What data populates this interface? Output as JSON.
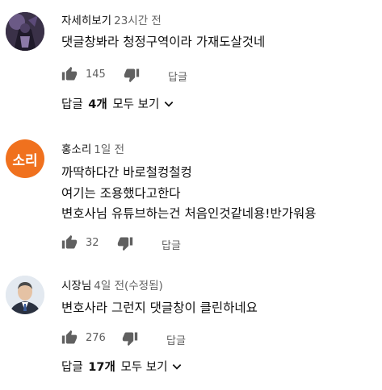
{
  "comments": [
    {
      "author": "자세히보기",
      "time": "23시간 전",
      "lines": [
        "댓글창봐라 청정구역이라 가재도살것네"
      ],
      "likes": "145",
      "reply_label": "답글",
      "avatar_icon": "dark-character-avatar",
      "replies": {
        "prefix": "답글",
        "count": "4개",
        "suffix": "모두 보기"
      }
    },
    {
      "author": "홍소리",
      "time": "1일 전",
      "lines": [
        "까딱하다간 바로철컹철컹",
        "여기는 조용했다고한다",
        "변호사님 유튜브하는건 처음인것같네용!반가워용"
      ],
      "likes": "32",
      "reply_label": "답글",
      "avatar_text": "소리",
      "avatar_color": "#f0711e"
    },
    {
      "author": "시장님",
      "time": "4일 전(수정됨)",
      "lines": [
        "변호사라 그런지 댓글창이 클린하네요"
      ],
      "likes": "276",
      "reply_label": "답글",
      "avatar_icon": "man-in-suit-avatar",
      "replies": {
        "prefix": "답글",
        "count": "17개",
        "suffix": "모두 보기"
      }
    }
  ],
  "colors": {
    "text": "#0f0f0f",
    "secondary": "#606060",
    "icon": "#606060"
  }
}
